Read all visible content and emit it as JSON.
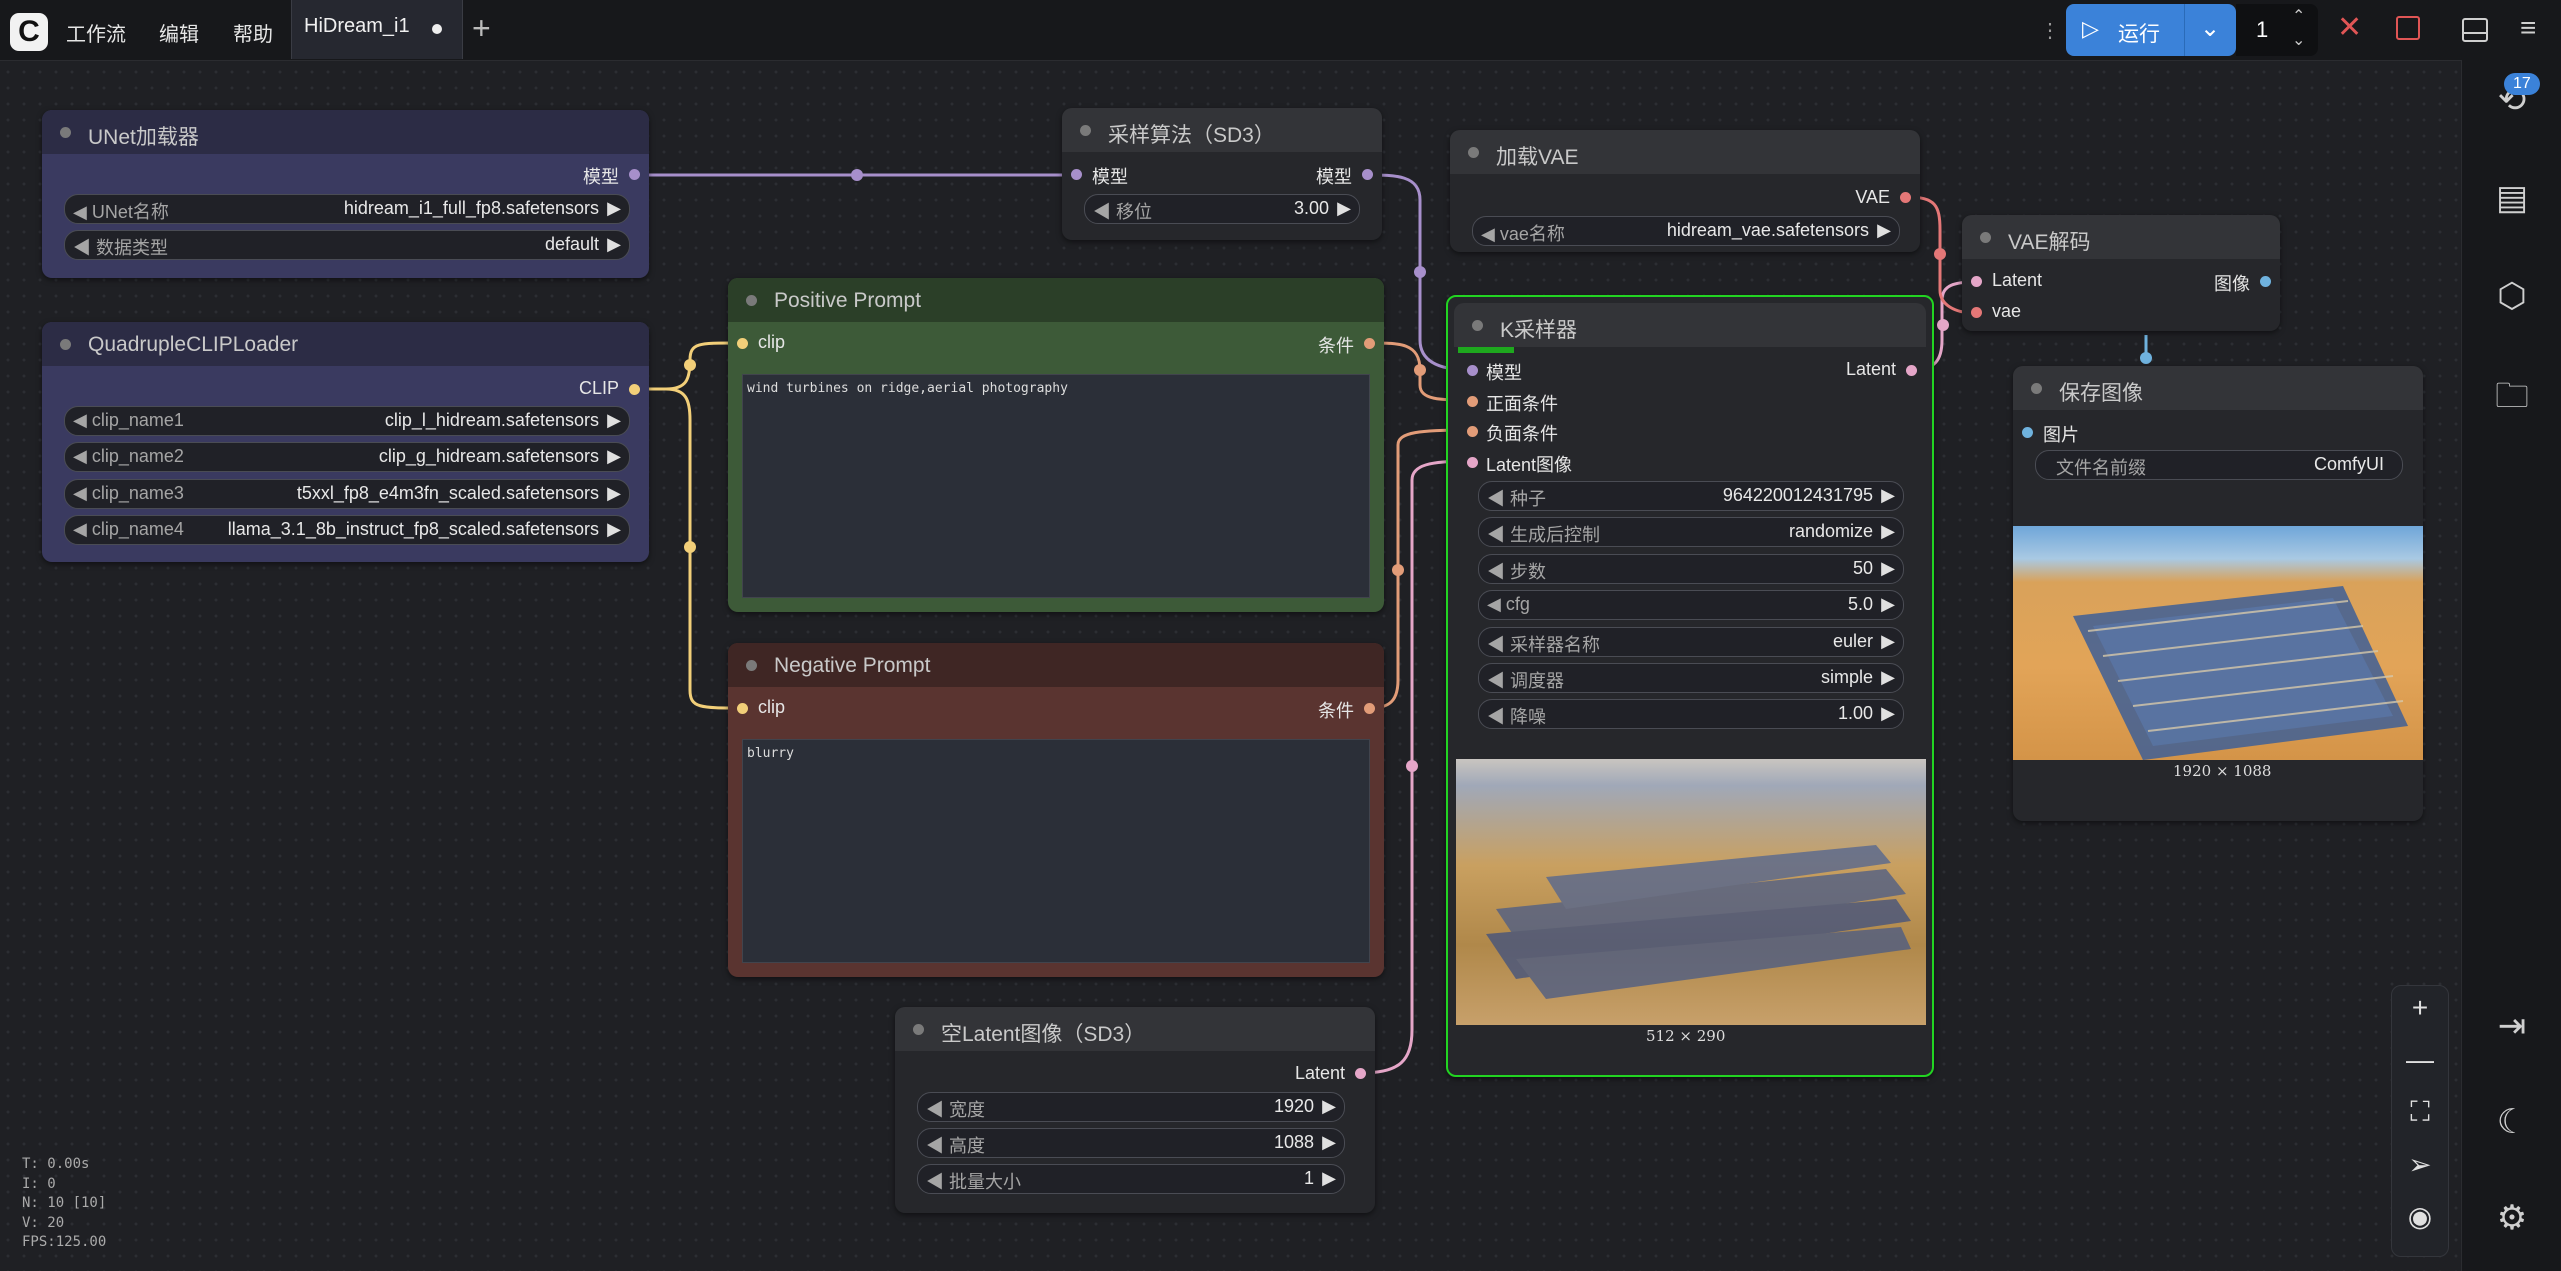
{
  "topbar": {
    "logo": "C",
    "menu": [
      "工作流",
      "编辑",
      "帮助"
    ],
    "tab_title": "HiDream_i1",
    "add_tab": "+",
    "run_label": "运行",
    "queue_count": "1"
  },
  "sidebar": {
    "queue_badge": "17",
    "icons": [
      "history-icon",
      "document-icon",
      "cube-icon",
      "folder-icon",
      "logout-icon",
      "moon-icon",
      "gear-icon"
    ]
  },
  "zoom_controls": [
    "zoom-in-icon",
    "zoom-out-icon",
    "fit-view-icon",
    "navigate-icon",
    "eye-icon"
  ],
  "stats": [
    "T: 0.00s",
    "I: 0",
    "N: 10 [10]",
    "V: 20",
    "FPS:125.00"
  ],
  "colors": {
    "canvas_bg": "#1f2024",
    "run_blue": "#3b82d9",
    "link_model": "#a78fcb",
    "link_clip": "#f2cf79",
    "link_cond": "#e29c78",
    "link_latent": "#e5a6c8",
    "link_vae": "#e47777",
    "link_image": "#6fb2de",
    "ksampler_border": "#22d422"
  },
  "nodes": {
    "unet": {
      "title": "UNet加载器",
      "output": "模型",
      "w1_label": "UNet名称",
      "w1_value": "hidream_i1_full_fp8.safetensors",
      "w2_label": "数据类型",
      "w2_value": "default"
    },
    "sampling": {
      "title": "采样算法（SD3）",
      "input": "模型",
      "output": "模型",
      "w1_label": "移位",
      "w1_value": "3.00"
    },
    "vae_loader": {
      "title": "加载VAE",
      "output": "VAE",
      "w1_label": "vae名称",
      "w1_value": "hidream_vae.safetensors"
    },
    "vae_decode": {
      "title": "VAE解码",
      "in1": "Latent",
      "in2": "vae",
      "output": "图像"
    },
    "clip_loader": {
      "title": "QuadrupleCLIPLoader",
      "output": "CLIP",
      "w1_label": "clip_name1",
      "w1_value": "clip_l_hidream.safetensors",
      "w2_label": "clip_name2",
      "w2_value": "clip_g_hidream.safetensors",
      "w3_label": "clip_name3",
      "w3_value": "t5xxl_fp8_e4m3fn_scaled.safetensors",
      "w4_label": "clip_name4",
      "w4_value": "llama_3.1_8b_instruct_fp8_scaled.safetensors"
    },
    "positive": {
      "title": "Positive Prompt",
      "input": "clip",
      "output": "条件",
      "text": "wind turbines on ridge,aerial photography"
    },
    "negative": {
      "title": "Negative Prompt",
      "input": "clip",
      "output": "条件",
      "text": "blurry"
    },
    "ksampler": {
      "title": "K采样器",
      "in_model": "模型",
      "in_pos": "正面条件",
      "in_neg": "负面条件",
      "in_latent": "Latent图像",
      "output": "Latent",
      "seed_label": "种子",
      "seed_value": "964220012431795",
      "ctrl_label": "生成后控制",
      "ctrl_value": "randomize",
      "steps_label": "步数",
      "steps_value": "50",
      "cfg_label": "cfg",
      "cfg_value": "5.0",
      "sampler_label": "采样器名称",
      "sampler_value": "euler",
      "sched_label": "调度器",
      "sched_value": "simple",
      "denoise_label": "降噪",
      "denoise_value": "1.00",
      "preview_size": "512 × 290"
    },
    "save_image": {
      "title": "保存图像",
      "input": "图片",
      "w1_label": "文件名前缀",
      "w1_value": "ComfyUI",
      "image_size": "1920 × 1088"
    },
    "empty_latent": {
      "title": "空Latent图像（SD3）",
      "output": "Latent",
      "w1_label": "宽度",
      "w1_value": "1920",
      "w2_label": "高度",
      "w2_value": "1088",
      "w3_label": "批量大小",
      "w3_value": "1"
    }
  }
}
